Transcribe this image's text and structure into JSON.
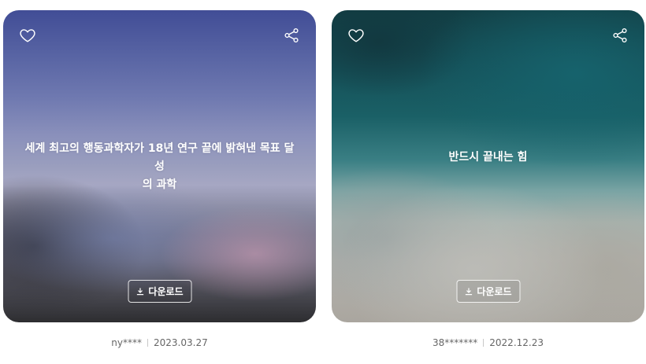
{
  "cards": [
    {
      "title_line1": "세계 최고의 행동과학자가 18년 연구 끝에 밝혀낸 목표 달성",
      "title_line2": "의 과학",
      "download_label": "다운로드",
      "author": "ny****",
      "date": "2023.03.27",
      "icons": [
        "heart-outline-icon",
        "share-icon",
        "download-icon"
      ]
    },
    {
      "title_line1": "반드시 끝내는 힘",
      "title_line2": "",
      "download_label": "다운로드",
      "author": "38*******",
      "date": "2022.12.23",
      "icons": [
        "heart-outline-icon",
        "share-icon",
        "download-icon"
      ]
    }
  ]
}
